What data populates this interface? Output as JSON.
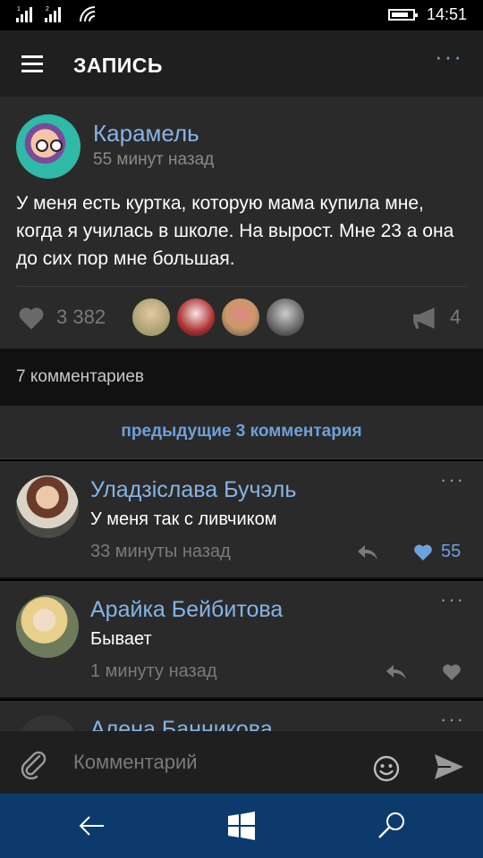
{
  "status": {
    "signal1": "1",
    "signal2": "2",
    "time": "14:51"
  },
  "app_bar": {
    "title": "ЗАПИСЬ",
    "more": "···"
  },
  "post": {
    "author": "Карамель",
    "time": "55 минут назад",
    "text": "У меня есть куртка, которую мама купила мне, когда я училась в школе. На вырост. Мне 23 а она до сих пор мне большая.",
    "likes": "3 382",
    "shares": "4",
    "liker_icons": [
      "avatar-1",
      "avatar-2",
      "avatar-3",
      "avatar-4"
    ]
  },
  "comments_header": {
    "count_label": "7 комментариев"
  },
  "prev_comments": {
    "label": "предыдущие 3 комментария"
  },
  "comments": [
    {
      "author": "Уладзіслава Бучэль",
      "text": "У меня так с ливчиком",
      "time": "33 минуты назад",
      "likes": "55",
      "more": "···"
    },
    {
      "author": "Арайка Бейбитова",
      "text": "Бывает",
      "time": "1 минуту назад",
      "likes": "",
      "more": "···"
    },
    {
      "author": "Алена Банникова",
      "more": "···"
    }
  ],
  "compose": {
    "placeholder": "Комментарий"
  },
  "colors": {
    "accent": "#6ea0dc",
    "author": "#86b4e6",
    "nav": "#0d3a6c"
  }
}
